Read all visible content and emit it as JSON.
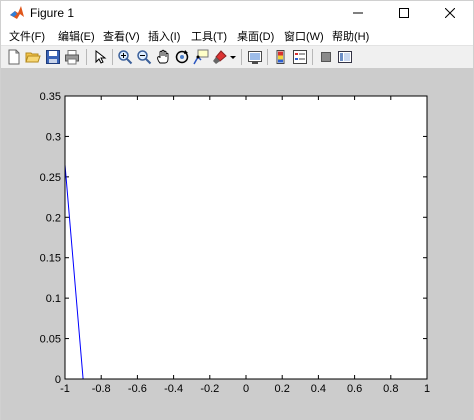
{
  "window": {
    "title": "Figure 1"
  },
  "menu": {
    "items": [
      "文件(F)",
      "编辑(E)",
      "查看(V)",
      "插入(I)",
      "工具(T)",
      "桌面(D)",
      "窗口(W)",
      "帮助(H)"
    ]
  },
  "toolbar": {
    "icons": [
      "new-figure-icon",
      "open-icon",
      "save-icon",
      "print-icon",
      "pointer-icon",
      "zoom-in-icon",
      "zoom-out-icon",
      "pan-icon",
      "rotate-icon",
      "data-cursor-icon",
      "brush-icon",
      "brush-dropdown-icon",
      "link-plot-icon",
      "colorbar-icon",
      "legend-icon",
      "hide-plot-tools-icon",
      "show-plot-tools-icon"
    ]
  },
  "chart_data": {
    "type": "line",
    "series": [
      {
        "x": [
          -1.0,
          -0.9,
          1.0
        ],
        "y": [
          0.265,
          0.0,
          0.0
        ],
        "color": "#0000ff"
      }
    ],
    "xlim": [
      -1,
      1
    ],
    "ylim": [
      0,
      0.35
    ],
    "xticks": [
      -1,
      -0.8,
      -0.6,
      -0.4,
      -0.2,
      0,
      0.2,
      0.4,
      0.6,
      0.8,
      1
    ],
    "yticks": [
      0,
      0.05,
      0.1,
      0.15,
      0.2,
      0.25,
      0.3,
      0.35
    ],
    "xtick_labels": [
      "-1",
      "-0.8",
      "-0.6",
      "-0.4",
      "-0.2",
      "0",
      "0.2",
      "0.4",
      "0.6",
      "0.8",
      "1"
    ],
    "ytick_labels": [
      "0",
      "0.05",
      "0.1",
      "0.15",
      "0.2",
      "0.25",
      "0.3",
      "0.35"
    ],
    "grid": false
  },
  "colors": {
    "figure_background": "#cccccc",
    "axes_background": "#ffffff",
    "line": "#0000ff"
  }
}
